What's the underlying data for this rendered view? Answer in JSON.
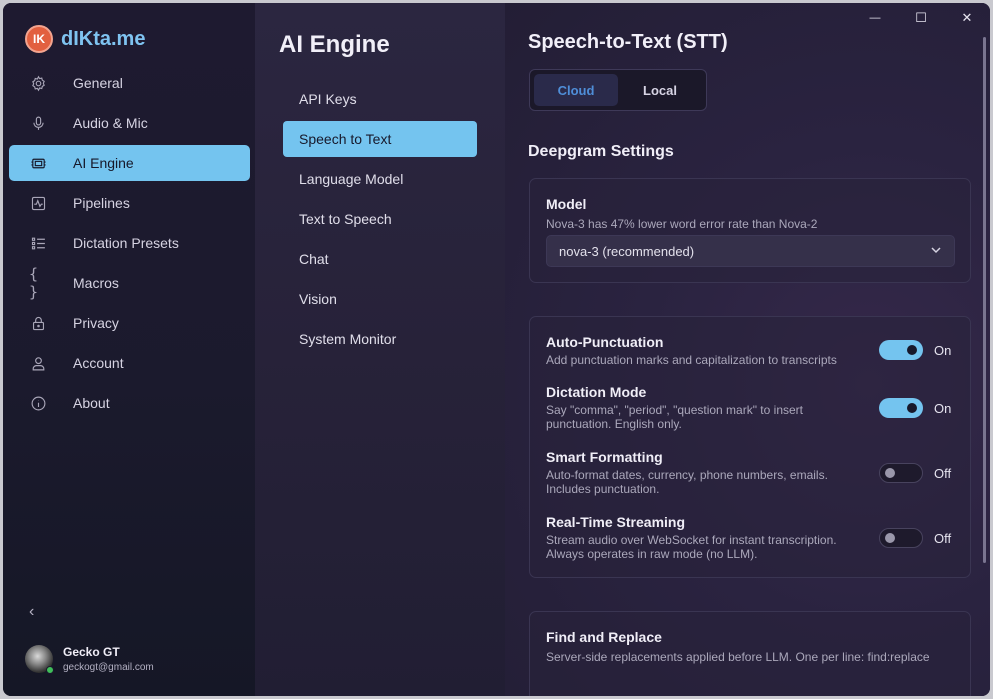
{
  "app": {
    "name": "dIKta.me",
    "logo_text": "IK"
  },
  "sidebar": {
    "items": [
      {
        "label": "General",
        "icon": "gear-icon"
      },
      {
        "label": "Audio & Mic",
        "icon": "microphone-icon"
      },
      {
        "label": "AI Engine",
        "icon": "chip-icon",
        "active": true
      },
      {
        "label": "Pipelines",
        "icon": "pulse-icon"
      },
      {
        "label": "Dictation Presets",
        "icon": "list-icon"
      },
      {
        "label": "Macros",
        "icon": "braces-icon"
      },
      {
        "label": "Privacy",
        "icon": "lock-icon"
      },
      {
        "label": "Account",
        "icon": "person-icon"
      },
      {
        "label": "About",
        "icon": "info-icon"
      }
    ],
    "collapse_glyph": "‹"
  },
  "user": {
    "name": "Gecko GT",
    "email": "geckogt@gmail.com"
  },
  "middle": {
    "title": "AI Engine",
    "items": [
      {
        "label": "API Keys"
      },
      {
        "label": "Speech to Text",
        "active": true
      },
      {
        "label": "Language Model"
      },
      {
        "label": "Text to Speech"
      },
      {
        "label": "Chat"
      },
      {
        "label": "Vision"
      },
      {
        "label": "System Monitor"
      }
    ]
  },
  "window_controls": {
    "minimize": "—",
    "maximize": "☐",
    "close": "✕"
  },
  "content": {
    "title": "Speech-to-Text (STT)",
    "mode_tabs": {
      "cloud": "Cloud",
      "local": "Local",
      "selected": "Cloud"
    },
    "section_title": "Deepgram Settings",
    "model": {
      "label": "Model",
      "description": "Nova-3 has 47% lower word error rate than Nova-2",
      "selected": "nova-3 (recommended)"
    },
    "toggles": [
      {
        "label": "Auto-Punctuation",
        "desc1": "Add punctuation marks and capitalization to transcripts",
        "desc2": "",
        "state": "On"
      },
      {
        "label": "Dictation Mode",
        "desc1": "Say \"comma\", \"period\", \"question mark\" to insert",
        "desc2": "punctuation. English only.",
        "state": "On"
      },
      {
        "label": "Smart Formatting",
        "desc1": "Auto-format dates, currency, phone numbers, emails.",
        "desc2": "Includes punctuation.",
        "state": "Off"
      },
      {
        "label": "Real-Time Streaming",
        "desc1": "Stream audio over WebSocket for instant transcription.",
        "desc2": "Always operates in raw mode (no LLM).",
        "state": "Off"
      }
    ],
    "find_replace": {
      "label": "Find and Replace",
      "description": "Server-side replacements applied before LLM. One per line: find:replace"
    }
  },
  "colors": {
    "accent": "#74c4ef",
    "brand": "#7fc3f0",
    "logo": "#e2603f",
    "segment_active_text": "#4f8ed8",
    "online": "#3fbf5a"
  }
}
